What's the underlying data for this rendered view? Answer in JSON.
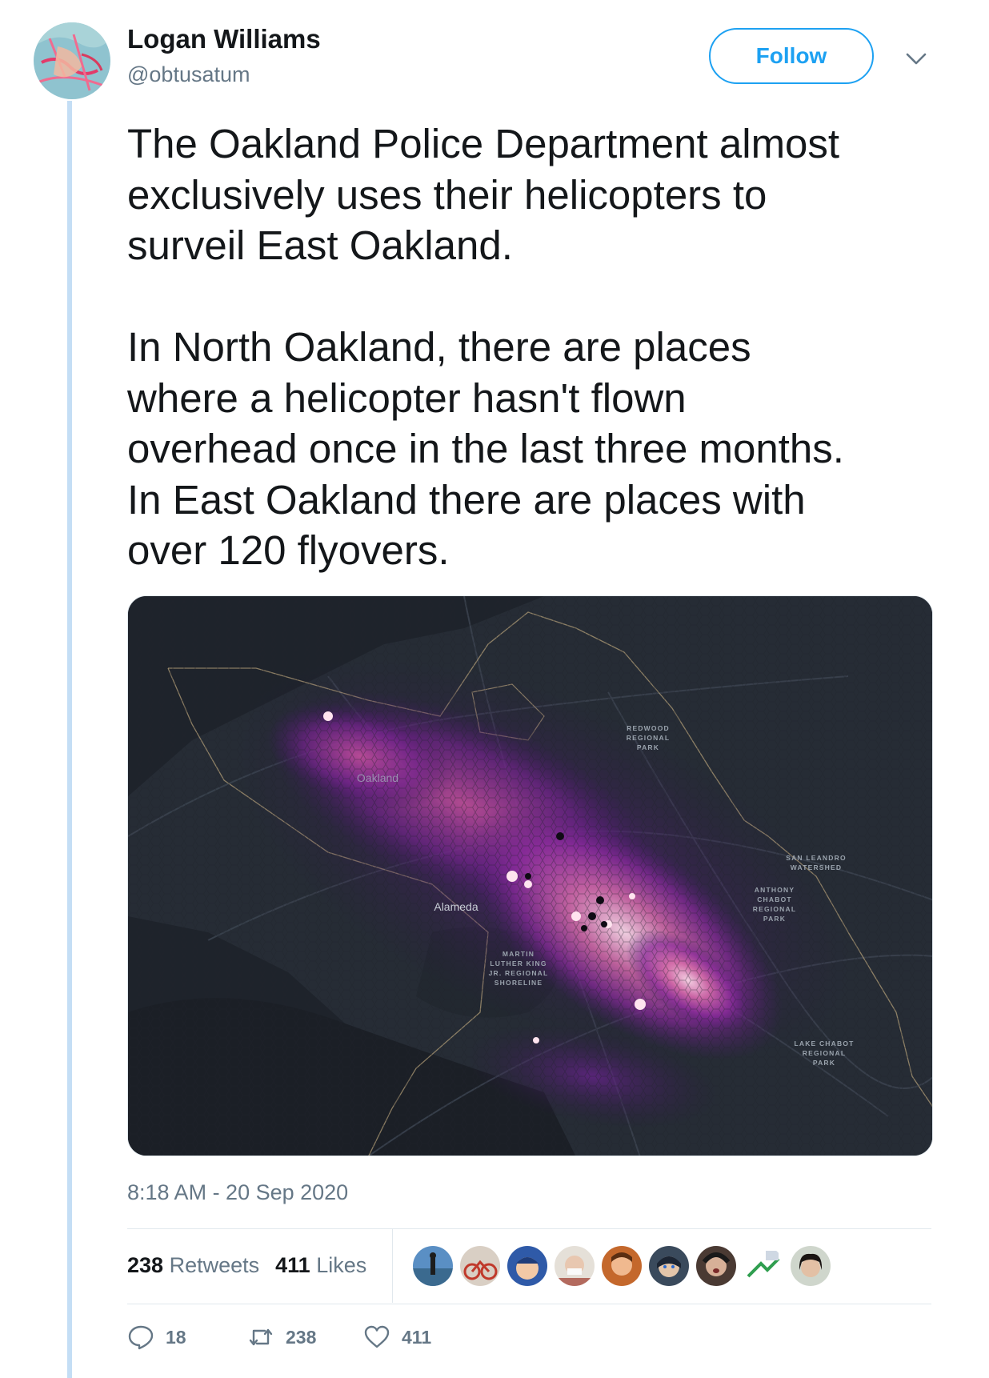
{
  "user": {
    "display_name": "Logan Williams",
    "handle": "@obtusatum"
  },
  "header": {
    "follow_label": "Follow",
    "caret_icon": "chevron-down-icon"
  },
  "tweet": {
    "text": "The Oakland Police Department almost\nexclusively uses their helicopters to\nsurveil East Oakland.\n\nIn North Oakland, there are places\nwhere a helicopter hasn't flown\noverhead once in the last three months.\nIn East Oakland there are places with\nover 120 flyovers.",
    "timestamp": "8:18 AM - 20 Sep 2020"
  },
  "map": {
    "labels": {
      "redwood": [
        "REDWOOD",
        "REGIONAL",
        "PARK"
      ],
      "oakland": "Oakland",
      "san_leandro": [
        "SAN LEANDRO",
        "WATERSHED"
      ],
      "chabot": [
        "ANTHONY",
        "CHABOT",
        "REGIONAL",
        "PARK"
      ],
      "alameda": "Alameda",
      "mlk": [
        "MARTIN",
        "LUTHER KING",
        "JR. REGIONAL",
        "SHORELINE"
      ],
      "lake_chabot": [
        "LAKE CHABOT",
        "REGIONAL",
        "PARK"
      ]
    }
  },
  "stats": {
    "retweets_count": "238",
    "retweets_label": "Retweets",
    "likes_count": "411",
    "likes_label": "Likes"
  },
  "actions": {
    "reply_count": "18",
    "retweet_count": "238",
    "like_count": "411"
  },
  "colors": {
    "accent": "#1da1f2",
    "secondary_text": "#657786",
    "thread_line": "#c4def5",
    "map_background": "#1e232b"
  }
}
